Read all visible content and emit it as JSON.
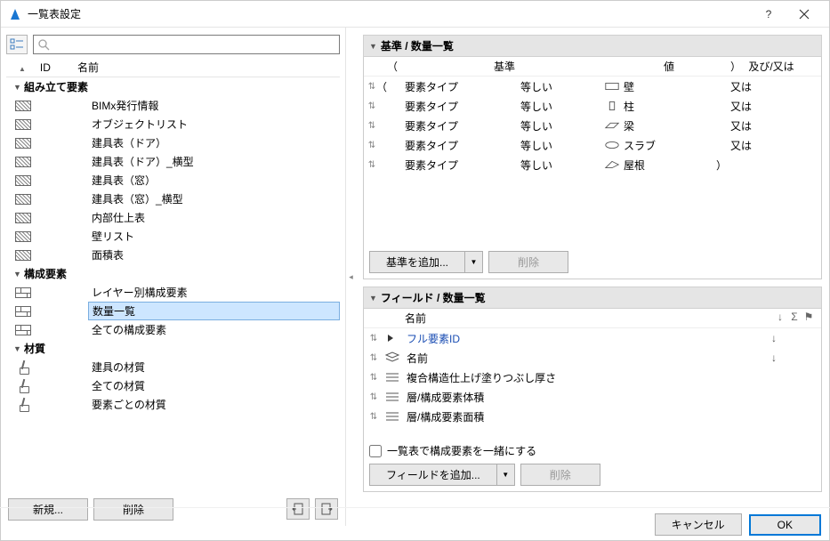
{
  "window": {
    "title": "一覧表設定"
  },
  "left": {
    "columns": {
      "id": "ID",
      "name": "名前"
    },
    "groups": [
      {
        "label": "組み立て要素",
        "iconType": "hatch",
        "items": [
          "BIMx発行情報",
          "オブジェクトリスト",
          "建具表（ドア）",
          "建具表（ドア）_横型",
          "建具表（窓）",
          "建具表（窓）_横型",
          "内部仕上表",
          "壁リスト",
          "面積表"
        ]
      },
      {
        "label": "構成要素",
        "iconType": "brick",
        "items": [
          "レイヤー別構成要素",
          "数量一覧",
          "全ての構成要素"
        ],
        "selected": 1
      },
      {
        "label": "材質",
        "iconType": "paint",
        "items": [
          "建具の材質",
          "全ての材質",
          "要素ごとの材質"
        ]
      }
    ],
    "buttons": {
      "new": "新規...",
      "delete": "削除"
    }
  },
  "criteria": {
    "header": "基準 /  数量一覧",
    "cols": {
      "open": "（",
      "criteria": "基準",
      "value": "値",
      "close": "）",
      "andor": "及び/又は"
    },
    "rows": [
      {
        "crit": "要素タイプ",
        "op": "等しい",
        "icon": "wall",
        "val": "壁",
        "andor": "又は"
      },
      {
        "crit": "要素タイプ",
        "op": "等しい",
        "icon": "column",
        "val": "柱",
        "andor": "又は"
      },
      {
        "crit": "要素タイプ",
        "op": "等しい",
        "icon": "beam",
        "val": "梁",
        "andor": "又は"
      },
      {
        "crit": "要素タイプ",
        "op": "等しい",
        "icon": "slab",
        "val": "スラブ",
        "andor": "又は"
      },
      {
        "crit": "要素タイプ",
        "op": "等しい",
        "icon": "roof",
        "val": "屋根",
        "close": "）",
        "andor": ""
      }
    ],
    "buttons": {
      "add": "基準を追加...",
      "delete": "削除"
    }
  },
  "fields": {
    "header": "フィールド /  数量一覧",
    "nameCol": "名前",
    "rows": [
      {
        "icon": "arrow",
        "name": "フル要素ID",
        "link": true,
        "sort": "↓"
      },
      {
        "icon": "layers",
        "name": "名前",
        "sort": "↓"
      },
      {
        "icon": "lines",
        "name": "複合構造仕上げ塗りつぶし厚さ"
      },
      {
        "icon": "lines",
        "name": "層/構成要素体積"
      },
      {
        "icon": "lines",
        "name": "層/構成要素面積"
      }
    ],
    "checkbox": "一覧表で構成要素を一緒にする",
    "buttons": {
      "add": "フィールドを追加...",
      "delete": "削除"
    }
  },
  "footer": {
    "cancel": "キャンセル",
    "ok": "OK"
  }
}
